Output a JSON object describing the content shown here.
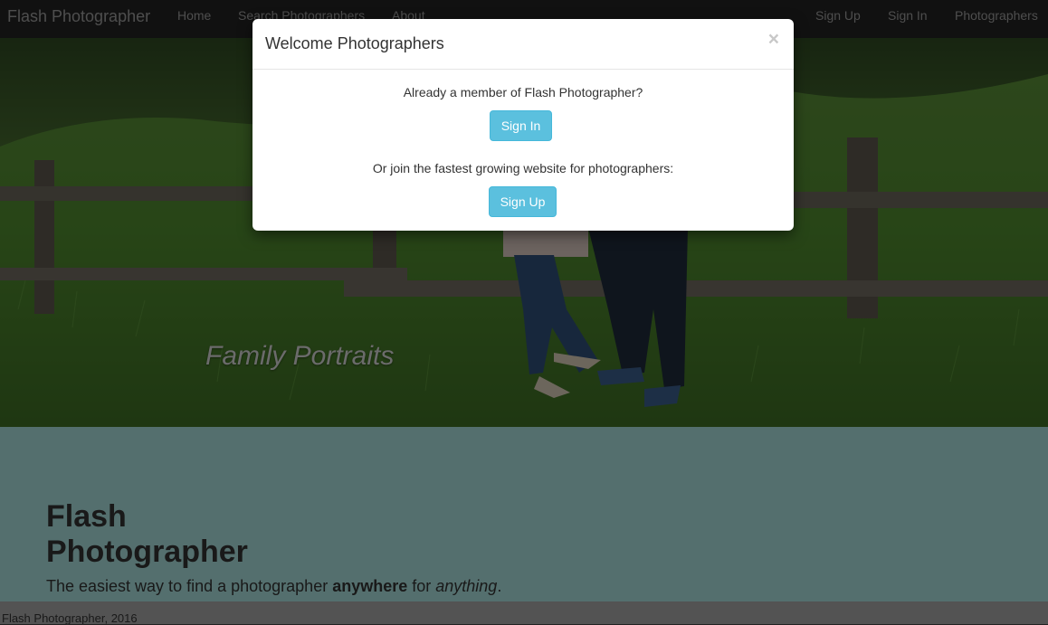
{
  "navbar": {
    "brand": "Flash Photographer",
    "left_links": [
      "Home",
      "Search Photographers",
      "About"
    ],
    "right_links": [
      "Sign Up",
      "Sign In",
      "Photographers"
    ]
  },
  "hero": {
    "caption": "Family Portraits"
  },
  "jumbotron": {
    "title": "Flash Photographer",
    "lead_prefix": "The easiest way to find a photographer ",
    "lead_bold": "anywhere",
    "lead_mid": " for ",
    "lead_italic": "anything",
    "lead_suffix": "."
  },
  "footer": {
    "text": "Flash Photographer, 2016"
  },
  "modal": {
    "title": "Welcome Photographers",
    "close_glyph": "×",
    "member_text": "Already a member of Flash Photographer?",
    "sign_in_label": "Sign In",
    "join_text": "Or join the fastest growing website for photographers:",
    "sign_up_label": "Sign Up"
  },
  "colors": {
    "navbar_bg": "#222222",
    "nav_text": "#9d9d9d",
    "jumbotron_bg": "#a9dfdc",
    "footer_bg": "#a6a6a6",
    "button_info": "#5bc0de"
  }
}
